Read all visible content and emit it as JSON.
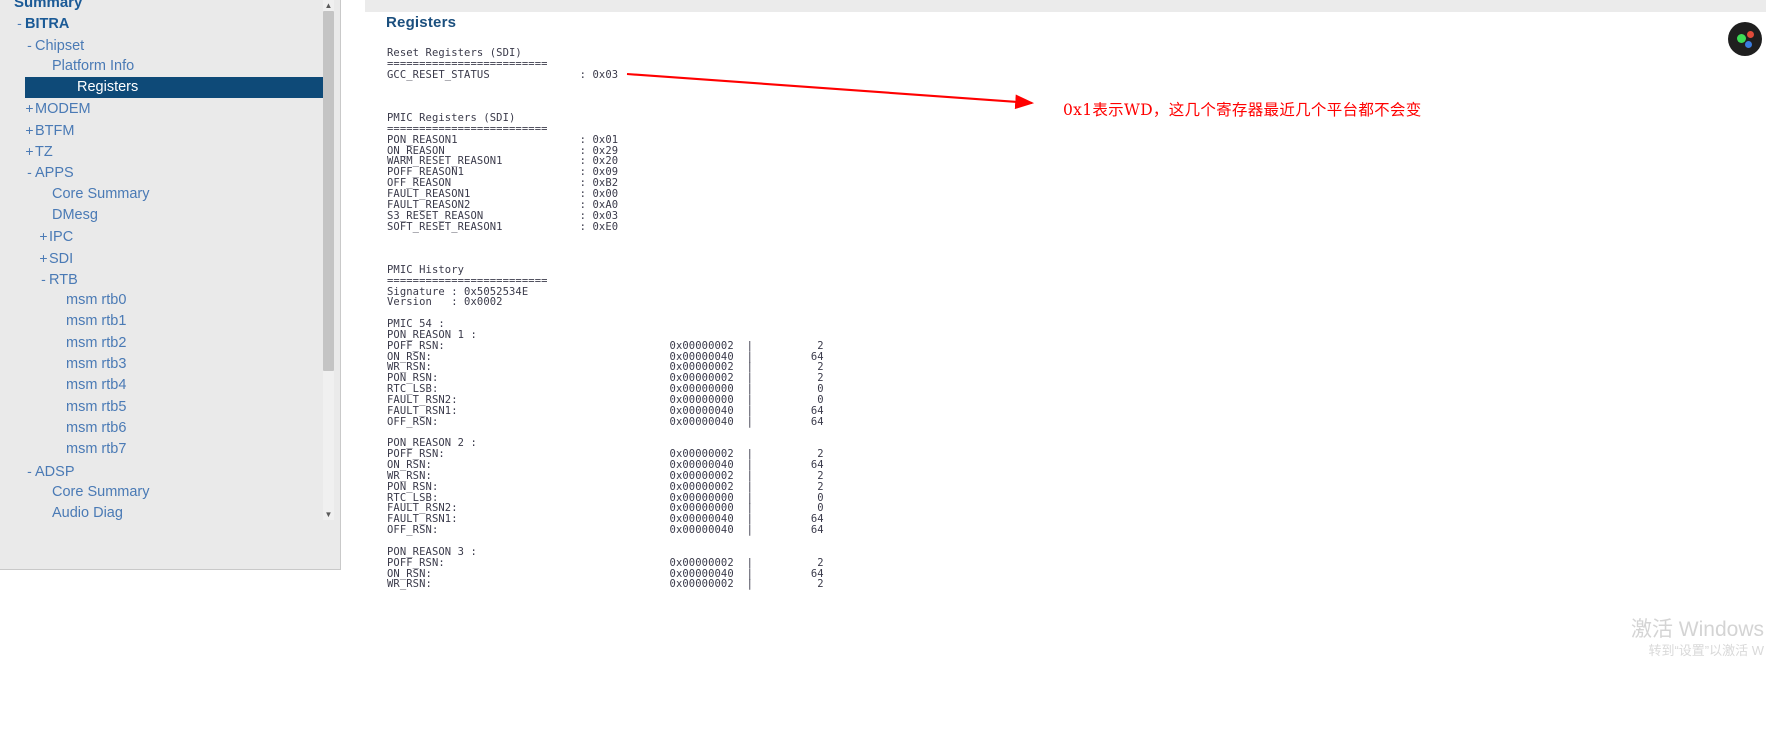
{
  "sidebar": {
    "header": "Summary",
    "items": [
      {
        "twisty": "-",
        "label": "BITRA",
        "indent": 0,
        "style": "root",
        "selected": false
      },
      {
        "twisty": "-",
        "label": "Chipset",
        "indent": 1,
        "style": "normal",
        "selected": false
      },
      {
        "twisty": "",
        "label": "Platform Info",
        "indent": 3,
        "style": "normal",
        "selected": false
      },
      {
        "twisty": "",
        "label": "Registers",
        "indent": 3,
        "style": "normal",
        "selected": true
      },
      {
        "twisty": "+",
        "label": "MODEM",
        "indent": 1,
        "style": "normal",
        "selected": false
      },
      {
        "twisty": "+",
        "label": "BTFM",
        "indent": 1,
        "style": "normal",
        "selected": false
      },
      {
        "twisty": "+",
        "label": "TZ",
        "indent": 1,
        "style": "normal",
        "selected": false
      },
      {
        "twisty": "-",
        "label": "APPS",
        "indent": 1,
        "style": "normal",
        "selected": false
      },
      {
        "twisty": "",
        "label": "Core Summary",
        "indent": 3,
        "style": "normal",
        "selected": false
      },
      {
        "twisty": "",
        "label": "DMesg",
        "indent": 3,
        "style": "normal",
        "selected": false
      },
      {
        "twisty": "+",
        "label": "IPC",
        "indent": 2,
        "style": "normal",
        "selected": false
      },
      {
        "twisty": "+",
        "label": "SDI",
        "indent": 2,
        "style": "normal",
        "selected": false
      },
      {
        "twisty": "-",
        "label": "RTB",
        "indent": 2,
        "style": "normal",
        "selected": false
      },
      {
        "twisty": "",
        "label": "msm rtb0",
        "indent": 4,
        "style": "normal",
        "selected": false
      },
      {
        "twisty": "",
        "label": "msm rtb1",
        "indent": 4,
        "style": "normal",
        "selected": false
      },
      {
        "twisty": "",
        "label": "msm rtb2",
        "indent": 4,
        "style": "normal",
        "selected": false
      },
      {
        "twisty": "",
        "label": "msm rtb3",
        "indent": 4,
        "style": "normal",
        "selected": false
      },
      {
        "twisty": "",
        "label": "msm rtb4",
        "indent": 4,
        "style": "normal",
        "selected": false
      },
      {
        "twisty": "",
        "label": "msm rtb5",
        "indent": 4,
        "style": "normal",
        "selected": false
      },
      {
        "twisty": "",
        "label": "msm rtb6",
        "indent": 4,
        "style": "normal",
        "selected": false
      },
      {
        "twisty": "",
        "label": "msm rtb7",
        "indent": 4,
        "style": "normal",
        "selected": false
      },
      {
        "twisty": "-",
        "label": "ADSP",
        "indent": 1,
        "style": "normal",
        "selected": false
      },
      {
        "twisty": "",
        "label": "Core Summary",
        "indent": 3,
        "style": "normal",
        "selected": false
      },
      {
        "twisty": "",
        "label": "Audio Diag",
        "indent": 3,
        "style": "normal",
        "selected": false
      }
    ],
    "scrollbar": {
      "up_arrow": "▲",
      "down_arrow": "▼"
    }
  },
  "panel": {
    "title": "Registers"
  },
  "dump": {
    "text": "Reset Registers (SDI)\n=========================\nGCC_RESET_STATUS              : 0x03\n\n\n\nPMIC Registers (SDI)\n=========================\nPON_REASON1                   : 0x01\nON_REASON                     : 0x29\nWARM_RESET_REASON1            : 0x20\nPOFF_REASON1                  : 0x09\nOFF_REASON                    : 0xB2\nFAULT_REASON1                 : 0x00\nFAULT_REASON2                 : 0xA0\nS3_RESET_REASON               : 0x03\nSOFT_RESET_REASON1            : 0xE0\n\n\n\nPMIC History\n=========================\nSignature : 0x5052534E\nVersion   : 0x0002\n\nPMIC 54 :\nPON_REASON 1 :\nPOFF_RSN:                                   0x00000002  |          2\nON_RSN:                                     0x00000040  |         64\nWR_RSN:                                     0x00000002  |          2\nPON_RSN:                                    0x00000002  |          2\nRTC_LSB:                                    0x00000000  |          0\nFAULT_RSN2:                                 0x00000000  |          0\nFAULT_RSN1:                                 0x00000040  |         64\nOFF_RSN:                                    0x00000040  |         64\n\nPON_REASON 2 :\nPOFF_RSN:                                   0x00000002  |          2\nON_RSN:                                     0x00000040  |         64\nWR_RSN:                                     0x00000002  |          2\nPON_RSN:                                    0x00000002  |          2\nRTC_LSB:                                    0x00000000  |          0\nFAULT_RSN2:                                 0x00000000  |          0\nFAULT_RSN1:                                 0x00000040  |         64\nOFF_RSN:                                    0x00000040  |         64\n\nPON_REASON 3 :\nPOFF_RSN:                                   0x00000002  |          2\nON_RSN:                                     0x00000040  |         64\nWR_RSN:                                     0x00000002  |          2"
  },
  "annotation": {
    "text": "0x1表示WD，这几个寄存器最近几个平台都不会变",
    "color": "#ff0000"
  },
  "watermark": {
    "line1": "激活 Windows",
    "line2": "转到“设置”以激活 W"
  }
}
